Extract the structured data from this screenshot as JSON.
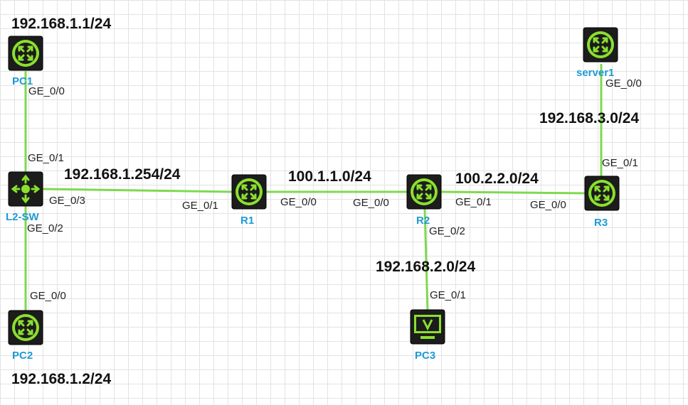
{
  "devices": {
    "pc1": {
      "label": "PC1",
      "icon": "router-icon"
    },
    "l2sw": {
      "label": "L2-SW",
      "icon": "switch-icon"
    },
    "pc2": {
      "label": "PC2",
      "icon": "router-icon"
    },
    "r1": {
      "label": "R1",
      "icon": "router-icon"
    },
    "r2": {
      "label": "R2",
      "icon": "router-icon"
    },
    "r3": {
      "label": "R3",
      "icon": "router-icon"
    },
    "server1": {
      "label": "server1",
      "icon": "router-icon"
    },
    "pc3": {
      "label": "PC3",
      "icon": "monitor-icon"
    }
  },
  "networks": {
    "pc1_addr": "192.168.1.1/24",
    "pc2_addr": "192.168.1.2/24",
    "lan1_gateway": "192.168.1.254/24",
    "r1_r2_net": "100.1.1.0/24",
    "r2_r3_net": "100.2.2.0/24",
    "r3_server_net": "192.168.3.0/24",
    "r2_pc3_net": "192.168.2.0/24"
  },
  "ports": {
    "pc1_ge": "GE_0/0",
    "sw_ge1": "GE_0/1",
    "sw_ge3": "GE_0/3",
    "sw_ge2": "GE_0/2",
    "pc2_ge": "GE_0/0",
    "r1_ge1": "GE_0/1",
    "r1_ge0": "GE_0/0",
    "r2_ge0": "GE_0/0",
    "r2_ge1": "GE_0/1",
    "r2_ge2": "GE_0/2",
    "r3_ge0": "GE_0/0",
    "r3_ge1": "GE_0/1",
    "server_ge": "GE_0/0",
    "pc3_ge": "GE_0/1"
  },
  "colors": {
    "link": "#7ed94f",
    "device_body": "#1c1c1c",
    "device_accent": "#8ae02e",
    "device_label": "#1e9ad6"
  }
}
